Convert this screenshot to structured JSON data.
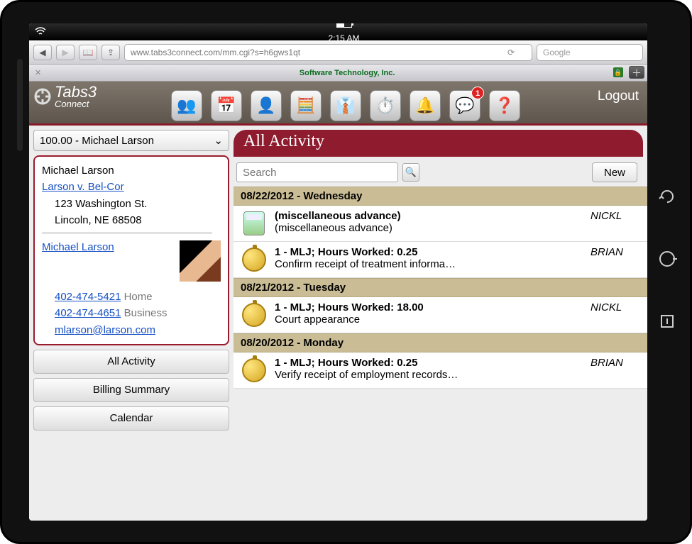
{
  "status": {
    "time": "2:15 AM"
  },
  "browser": {
    "url": "www.tabs3connect.com/mm.cgi?s=h6gws1qt",
    "search_placeholder": "Google",
    "tab_title": "Software Technology, Inc."
  },
  "app": {
    "brand1": "Tabs3",
    "brand2": "Connect",
    "logout": "Logout",
    "msg_badge": "1"
  },
  "matter_picker": "100.00 - Michael Larson",
  "card": {
    "name": "Michael Larson",
    "case": "Larson v. Bel-Cor",
    "addr1": "123 Washington St.",
    "addr2": "Lincoln, NE 68508",
    "contact": "Michael Larson",
    "phone1": "402-474-5421",
    "phone1_lbl": "Home",
    "phone2": "402-474-4651",
    "phone2_lbl": "Business",
    "email": "mlarson@larson.com"
  },
  "nav": {
    "all_activity": "All Activity",
    "billing": "Billing Summary",
    "calendar": "Calendar"
  },
  "heading": "All Activity",
  "search_placeholder": "Search",
  "new_label": "New",
  "groups": [
    {
      "date": "08/22/2012 - Wednesday",
      "entries": [
        {
          "icon": "calc",
          "title": "(miscellaneous advance)",
          "desc": "(miscellaneous advance)",
          "user": "NICKL"
        },
        {
          "icon": "stopwatch",
          "title": "1 - MLJ;  Hours Worked:  0.25",
          "desc": "Confirm receipt of treatment informa…",
          "user": "BRIAN"
        }
      ]
    },
    {
      "date": "08/21/2012 - Tuesday",
      "entries": [
        {
          "icon": "stopwatch",
          "title": "1 - MLJ;  Hours Worked:  18.00",
          "desc": "Court appearance",
          "user": "NICKL"
        }
      ]
    },
    {
      "date": "08/20/2012 - Monday",
      "entries": [
        {
          "icon": "stopwatch",
          "title": "1 - MLJ;  Hours Worked:  0.25",
          "desc": "Verify receipt of employment records…",
          "user": "BRIAN"
        }
      ]
    }
  ]
}
